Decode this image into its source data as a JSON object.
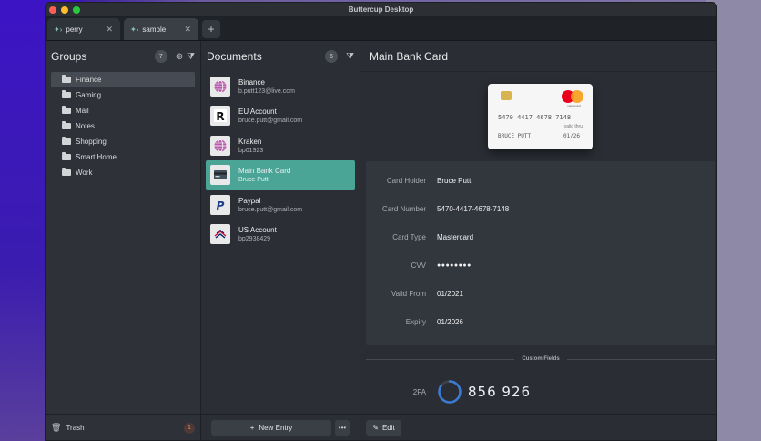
{
  "window": {
    "title": "Buttercup Desktop"
  },
  "tabs": [
    {
      "label": "perry",
      "active": false
    },
    {
      "label": "sample",
      "active": true
    }
  ],
  "groups": {
    "title": "Groups",
    "count": "7",
    "items": [
      {
        "label": "Finance",
        "active": true
      },
      {
        "label": "Gaming"
      },
      {
        "label": "Mail"
      },
      {
        "label": "Notes"
      },
      {
        "label": "Shopping"
      },
      {
        "label": "Smart Home"
      },
      {
        "label": "Work"
      }
    ],
    "trash_label": "Trash",
    "trash_count": "1"
  },
  "documents": {
    "title": "Documents",
    "count": "6",
    "items": [
      {
        "title": "Binance",
        "subtitle": "b.putt123@live.com",
        "icon": "globe-icon"
      },
      {
        "title": "EU Account",
        "subtitle": "bruce.putt@gmail.com",
        "icon": "revolut-icon"
      },
      {
        "title": "Kraken",
        "subtitle": "bp01923",
        "icon": "globe-icon"
      },
      {
        "title": "Main Bank Card",
        "subtitle": "Bruce Putt",
        "icon": "credit-card-icon",
        "active": true
      },
      {
        "title": "Paypal",
        "subtitle": "bruce.putt@gmail.com",
        "icon": "paypal-icon"
      },
      {
        "title": "US Account",
        "subtitle": "bp2938429",
        "icon": "bank-of-america-icon"
      }
    ],
    "new_entry_label": "New Entry",
    "more_label": "•••"
  },
  "detail": {
    "title": "Main Bank Card",
    "card": {
      "number": "5470 4417 4678 7148",
      "valid_label": "valid thru",
      "expiry": "01/26",
      "holder": "BRUCE PUTT",
      "brand_text": "mastercard"
    },
    "fields": [
      {
        "label": "Card Holder",
        "value": "Bruce Putt"
      },
      {
        "label": "Card Number",
        "value": "5470-4417-4678-7148"
      },
      {
        "label": "Card Type",
        "value": "Mastercard"
      },
      {
        "label": "CVV",
        "value": "●●●●●●●●"
      },
      {
        "label": "Valid From",
        "value": "01/2021"
      },
      {
        "label": "Expiry",
        "value": "01/2026"
      }
    ],
    "custom_fields_label": "Custom Fields",
    "totp": {
      "label": "2FA",
      "code": "856 926",
      "progress": 0.85
    },
    "edit_label": "Edit"
  },
  "colors": {
    "accent": "#4aa597",
    "window_bg": "#2a2e35"
  }
}
